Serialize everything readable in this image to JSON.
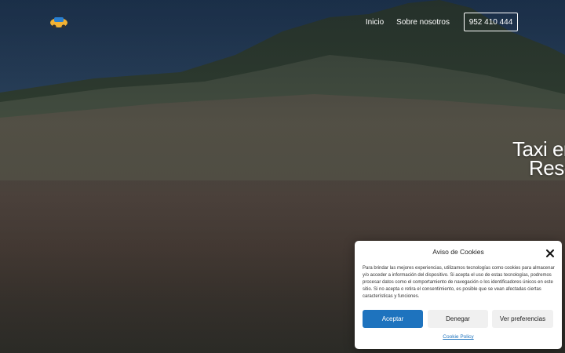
{
  "header": {
    "logo_icon": "taxi-logo-icon",
    "nav": [
      {
        "label": "Inicio"
      },
      {
        "label": "Sobre nosotros"
      }
    ],
    "phone_label": "952 410 444"
  },
  "hero": {
    "title_line1": "Taxi en",
    "title_line2": "Rese"
  },
  "cookie_banner": {
    "title": "Aviso de Cookies",
    "close_icon": "close-icon",
    "text": "Para brindar las mejores experiencias, utilizamos tecnologías como cookies para almacenar y/o acceder a información del dispositivo. Si acepta el uso de estas tecnologías, podremos procesar datos como el comportamiento de navegación o los identificadores únicos en este sitio. Si no acepta o retira el consentimiento, es posible que se vean afectadas ciertas características y funciones.",
    "accept_label": "Aceptar",
    "deny_label": "Denegar",
    "preferences_label": "Ver preferencias",
    "policy_label": "Cookie Policy"
  },
  "colors": {
    "accent": "#1e73be",
    "overlay": "#0a121e"
  }
}
